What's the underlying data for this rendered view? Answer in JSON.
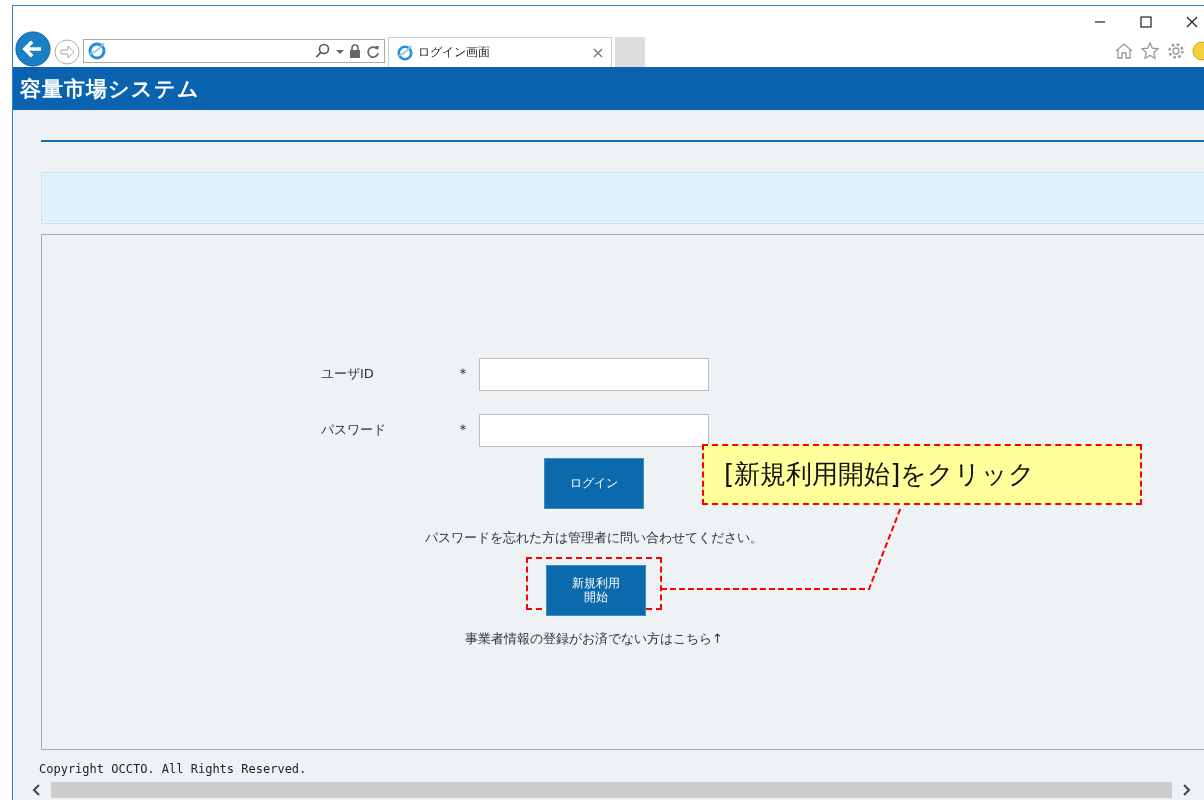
{
  "browser": {
    "tabs": [
      {
        "title": "ログイン画面",
        "selected": true
      }
    ]
  },
  "header": {
    "title": "容量市場システム"
  },
  "login_form": {
    "fields": [
      {
        "label": "ユーザID",
        "required_mark": "＊"
      },
      {
        "label": "パスワード",
        "required_mark": "＊"
      }
    ],
    "login_button": "ログイン",
    "forgot_note": "パスワードを忘れた方は管理者に問い合わせてください。",
    "new_user_button": "新規利用開始",
    "new_user_note": "事業者情報の登録がお済でない方はこちら↑"
  },
  "callout": {
    "text": "[新規利用開始]をクリック"
  },
  "footer": {
    "copyright": "Copyright OCCTO. All Rights Reserved."
  }
}
